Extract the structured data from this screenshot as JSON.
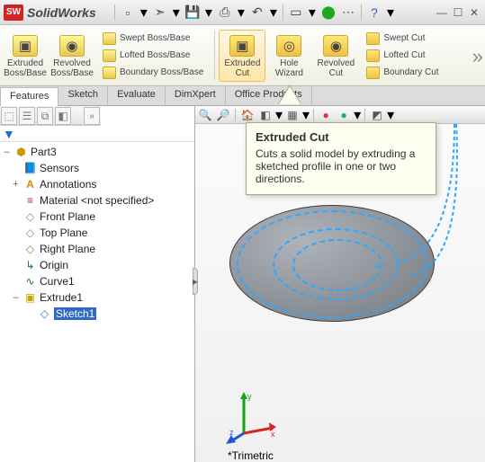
{
  "app": {
    "icon_text": "SW",
    "name": "SolidWorks"
  },
  "qat_icons": [
    "new-doc-icon",
    "open-icon",
    "save-icon",
    "print-icon",
    "undo-icon",
    "select-icon",
    "rebuild-icon",
    "options-icon",
    "help-icon"
  ],
  "qat_glyphs": [
    "▫",
    "➣",
    "💾",
    "⎙",
    "↶",
    "▭",
    "⬤",
    "⋯",
    "?"
  ],
  "ribbon": {
    "extruded_boss": "Extruded Boss/Base",
    "revolved_boss": "Revolved Boss/Base",
    "swept_boss": "Swept Boss/Base",
    "lofted_boss": "Lofted Boss/Base",
    "boundary_boss": "Boundary Boss/Base",
    "extruded_cut": "Extruded Cut",
    "hole_wizard": "Hole Wizard",
    "revolved_cut": "Revolved Cut",
    "swept_cut": "Swept Cut",
    "lofted_cut": "Lofted Cut",
    "boundary_cut": "Boundary Cut"
  },
  "tabs": [
    "Features",
    "Sketch",
    "Evaluate",
    "DimXpert",
    "Office Products"
  ],
  "active_tab": "Features",
  "tree": {
    "root": "Part3",
    "items": [
      {
        "label": "Sensors",
        "icon": "📘",
        "tw": ""
      },
      {
        "label": "Annotations",
        "icon": "A",
        "tw": "+",
        "color": "#d88b00"
      },
      {
        "label": "Material <not specified>",
        "icon": "≡",
        "tw": "",
        "color": "#b02f2f"
      },
      {
        "label": "Front Plane",
        "icon": "◇",
        "tw": "",
        "color": "#8a8a4a"
      },
      {
        "label": "Top Plane",
        "icon": "◇",
        "tw": "",
        "color": "#8a8a4a"
      },
      {
        "label": "Right Plane",
        "icon": "◇",
        "tw": "",
        "color": "#8a8a4a"
      },
      {
        "label": "Origin",
        "icon": "↳",
        "tw": "",
        "color": "#1b7a1b"
      },
      {
        "label": "Curve1",
        "icon": "∿",
        "tw": "",
        "color": "#1b7a1b"
      },
      {
        "label": "Extrude1",
        "icon": "▣",
        "tw": "–",
        "color": "#c9a200"
      }
    ],
    "child": {
      "label": "Sketch1",
      "icon": "◇",
      "color": "#2c7ac9"
    }
  },
  "tooltip": {
    "title": "Extruded Cut",
    "body": "Cuts a solid model by extruding a sketched profile in one or two directions."
  },
  "view_label": "*Trimetric",
  "triad": {
    "x": "x",
    "y": "y",
    "z": "z"
  }
}
